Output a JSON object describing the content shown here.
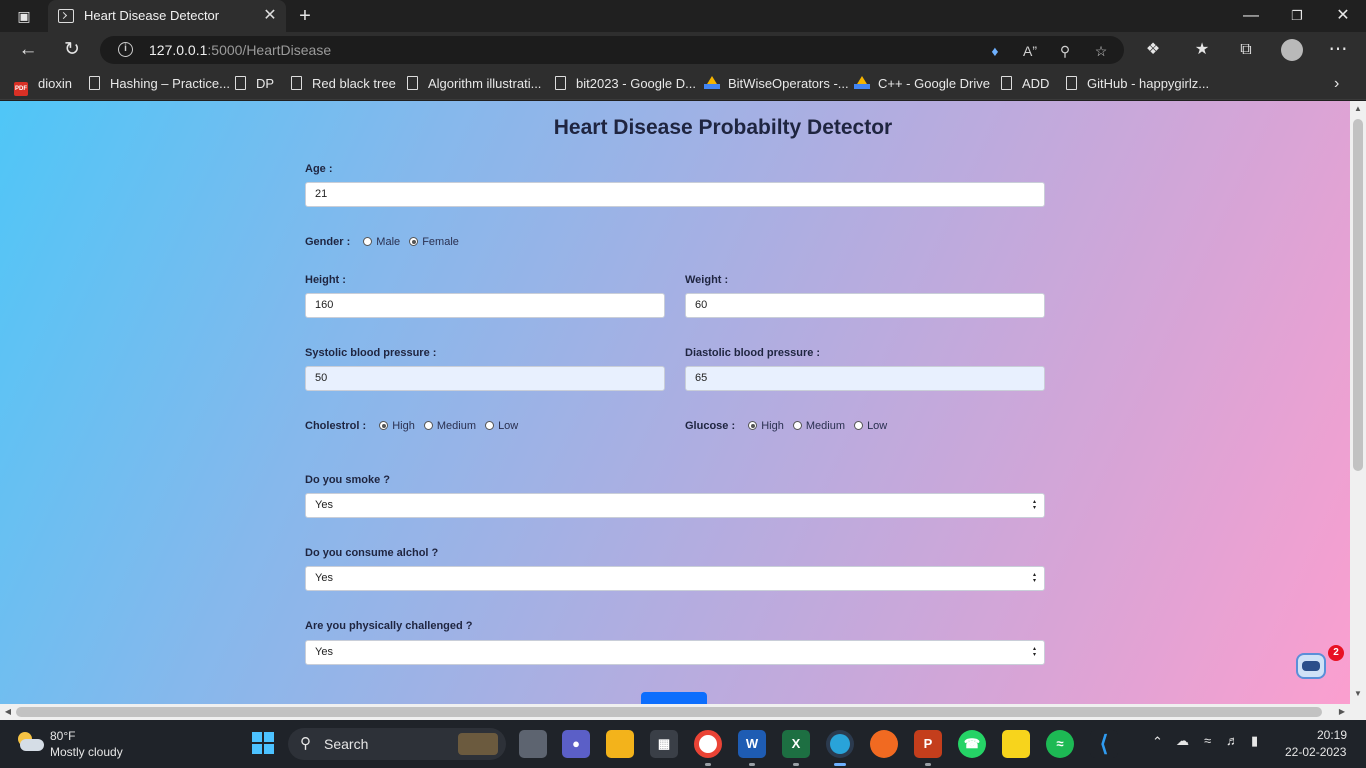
{
  "browser": {
    "tab_title": "Heart Disease Detector",
    "url_host": "127.0.0.1",
    "url_rest": ":5000/HeartDisease",
    "new_tab": "+",
    "bookmarks": [
      {
        "label": "dioxin",
        "icon": "pdf-icon"
      },
      {
        "label": "Hashing – Practice...",
        "icon": "document-icon"
      },
      {
        "label": "DP",
        "icon": "document-icon"
      },
      {
        "label": "Red black tree",
        "icon": "document-icon"
      },
      {
        "label": "Algorithm illustrati...",
        "icon": "document-icon"
      },
      {
        "label": "bit2023 - Google D...",
        "icon": "document-icon"
      },
      {
        "label": "BitWiseOperators -...",
        "icon": "google-drive-icon"
      },
      {
        "label": "C++ - Google Drive",
        "icon": "google-drive-icon"
      },
      {
        "label": "ADD",
        "icon": "document-icon"
      },
      {
        "label": "GitHub - happygirlz...",
        "icon": "document-icon"
      }
    ]
  },
  "page": {
    "title": "Heart Disease Probabilty Detector",
    "age": {
      "label": "Age :",
      "value": "21"
    },
    "gender": {
      "label": "Gender :",
      "options": [
        "Male",
        "Female"
      ],
      "selected": "Female"
    },
    "height": {
      "label": "Height :",
      "value": "160"
    },
    "weight": {
      "label": "Weight :",
      "value": "60"
    },
    "systolic": {
      "label": "Systolic blood pressure :",
      "value": "50"
    },
    "diastolic": {
      "label": "Diastolic blood pressure :",
      "value": "65"
    },
    "cholestrol": {
      "label": "Cholestrol :",
      "options": [
        "High",
        "Medium",
        "Low"
      ],
      "selected": "High"
    },
    "glucose": {
      "label": "Glucose :",
      "options": [
        "High",
        "Medium",
        "Low"
      ],
      "selected": "High"
    },
    "smoke": {
      "label": "Do you smoke ?",
      "value": "Yes"
    },
    "alcohol": {
      "label": "Do you consume alchol ?",
      "value": "Yes"
    },
    "physical": {
      "label": "Are you physically challenged ?",
      "value": "Yes"
    },
    "chatbot_badge": "2"
  },
  "taskbar": {
    "weather_temp": "80°F",
    "weather_desc": "Mostly cloudy",
    "search_label": "Search",
    "time": "20:19",
    "date": "22-02-2023"
  },
  "colors": {
    "accent": "#0d6efd",
    "gradient_start": "#4fc6f7",
    "gradient_end": "#fb9fcf",
    "badge": "#e81123"
  }
}
